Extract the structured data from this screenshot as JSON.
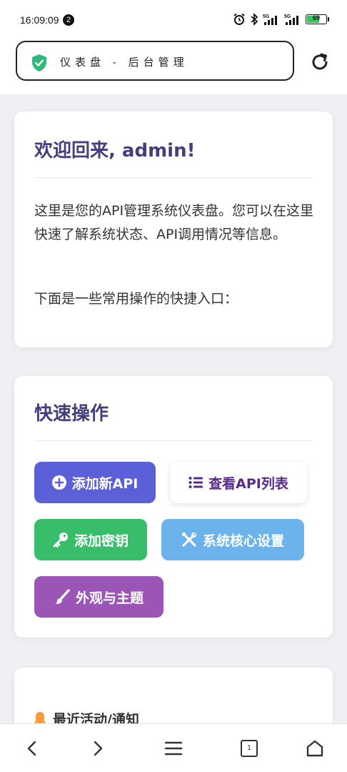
{
  "status_bar": {
    "time": "16:09:09",
    "notification_count": "2",
    "network_1": "5G",
    "network_2": "5G",
    "battery": "69",
    "battery_level_pct": 69,
    "icons": [
      "alarm-icon",
      "bluetooth-icon",
      "signal-icon",
      "battery-icon"
    ]
  },
  "browser": {
    "address_text": "仪表盘 - 后台管理",
    "security_icon": "shield-check-icon",
    "security_color": "#2fb87a",
    "reload_icon": "reload-icon"
  },
  "welcome": {
    "title": "欢迎回来, admin!",
    "paragraph1": "这里是您的API管理系统仪表盘。您可以在这里快速了解系统状态、API调用情况等信息。",
    "paragraph2": "下面是一些常用操作的快捷入口："
  },
  "quick_actions": {
    "title": "快速操作",
    "buttons": [
      {
        "label": "添加新API",
        "icon": "plus-circle-icon",
        "color": "#5b60d8"
      },
      {
        "label": "查看API列表",
        "icon": "list-icon",
        "color": "#ffffff"
      },
      {
        "label": "添加密钥",
        "icon": "key-icon",
        "color": "#38bd6b"
      },
      {
        "label": "系统核心设置",
        "icon": "tools-icon",
        "color": "#6bb3ea"
      },
      {
        "label": "外观与主题",
        "icon": "paint-brush-icon",
        "color": "#9b55b6"
      }
    ]
  },
  "activity": {
    "title": "最近活动/通知",
    "icon": "bell-icon"
  },
  "bottom_nav": {
    "tab_count": "1",
    "items": [
      "back-icon",
      "forward-icon",
      "menu-icon",
      "tabs-icon",
      "home-icon"
    ]
  },
  "colors": {
    "title": "#433e7c",
    "page_bg": "#eef0f3"
  }
}
